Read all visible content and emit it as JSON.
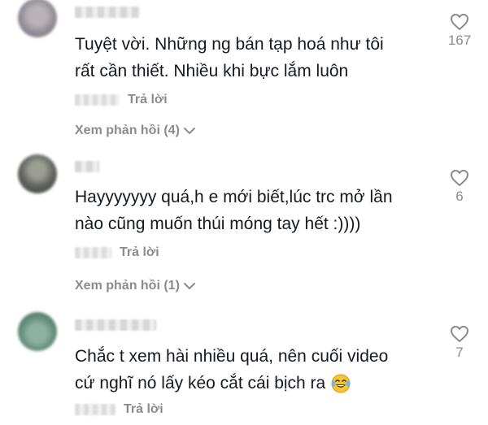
{
  "comments": [
    {
      "text_line1": "Tuyệt vời. Những ng bán tạp hoá như tôi",
      "text_line2": "rất cần thiết. Nhiều khi bực lắm luôn",
      "reply_label": "Trả lời",
      "likes": "167",
      "view_replies": "Xem phản hồi (4)"
    },
    {
      "text_line1": "Hayyyyyyy quá,h e mới biết,lúc trc mở lần",
      "text_line2": "nào cũng muốn thúi móng tay hết :))))",
      "reply_label": "Trả lời",
      "likes": "6",
      "view_replies": "Xem phản hồi (1)"
    },
    {
      "text_line1": "Chắc t xem hài nhiều quá, nên cuối video",
      "text_line2": "cứ nghĩ nó lấy kéo cắt cái bịch ra",
      "reply_label": "Trả lời",
      "likes": "7"
    }
  ],
  "colors": {
    "text": "#161823",
    "secondary": "#8a8b91",
    "background": "#ffffff"
  },
  "icons": {
    "like": "heart-outline-icon",
    "expand": "chevron-down-icon",
    "emoji": "laughing-tears-emoji"
  }
}
